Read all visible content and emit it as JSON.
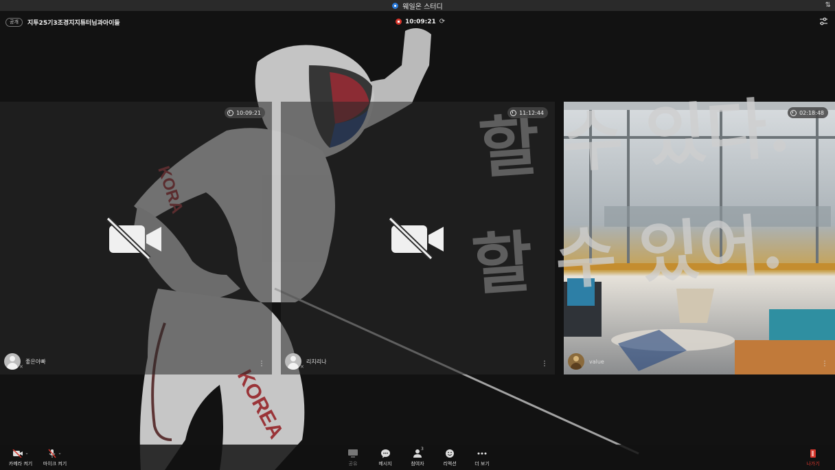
{
  "window": {
    "title": "웨일온 스터디"
  },
  "header": {
    "badge": "공개",
    "room_title": "지투25기3조경지지튜터님과아이들",
    "timer": "10:09:21"
  },
  "background_art": {
    "calligraphy_line_1": "할 수 있다.",
    "calligraphy_line_2": "할 수 있어."
  },
  "tiles": [
    {
      "time": "10:09:21",
      "name": "좋은아빠",
      "camera": "off"
    },
    {
      "time": "11:12:44",
      "name": "리치리나",
      "camera": "off"
    },
    {
      "time": "02:18:48",
      "name": "value",
      "camera": "on"
    }
  ],
  "toolbar": {
    "camera": "카메라 켜기",
    "mic": "마이크 켜기",
    "share": "공유",
    "message": "메시지",
    "participants": "참여자",
    "participants_count": "3",
    "reaction": "리액션",
    "more": "더 보기",
    "leave": "나가기"
  },
  "colors": {
    "accent_red": "#d8362c",
    "accent_blue": "#2a79d8"
  }
}
